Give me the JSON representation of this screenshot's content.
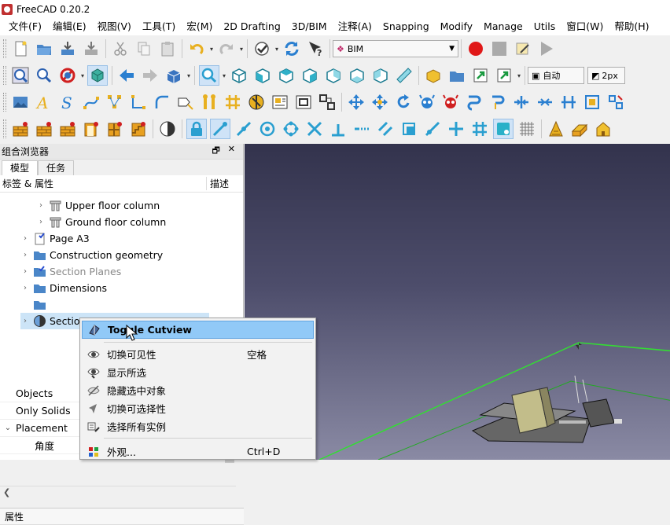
{
  "window": {
    "title": "FreeCAD 0.20.2"
  },
  "menubar": {
    "items": [
      "文件(F)",
      "编辑(E)",
      "视图(V)",
      "工具(T)",
      "宏(M)",
      "2D Drafting",
      "3D/BIM",
      "注释(A)",
      "Snapping",
      "Modify",
      "Manage",
      "Utils",
      "窗口(W)",
      "帮助(H)"
    ]
  },
  "toolbar": {
    "workbench_combo": "BIM",
    "draw_style_combo": "自动",
    "line_width_combo": "2px"
  },
  "panel": {
    "title": "组合浏览器",
    "tabs": [
      "模型",
      "任务"
    ],
    "active_tab": "模型",
    "col_label": "标签 & 属性",
    "col_desc": "描述",
    "tree": [
      {
        "label": "Upper floor column",
        "icon": "column-icon",
        "dim": false
      },
      {
        "label": "Ground floor column",
        "icon": "column-icon",
        "dim": false
      },
      {
        "label": "Page A3",
        "icon": "page-icon",
        "dim": false
      },
      {
        "label": "Construction geometry",
        "icon": "folder-icon",
        "dim": false
      },
      {
        "label": "Section Planes",
        "icon": "section-folder-icon",
        "dim": true
      },
      {
        "label": "Dimensions",
        "icon": "folder-icon",
        "dim": false
      },
      {
        "label": "",
        "icon": "folder-icon",
        "dim": false
      },
      {
        "label": "Section",
        "icon": "section-plane-icon",
        "dim": false
      }
    ]
  },
  "properties": {
    "header": "属性",
    "rows": [
      {
        "label": "Objects",
        "chev": ""
      },
      {
        "label": "Only Solids",
        "chev": ""
      },
      {
        "label": "Placement",
        "chev": "v"
      },
      {
        "label": "角度",
        "chev": ""
      }
    ]
  },
  "context_menu": {
    "items": [
      {
        "label": "Toggle Cutview",
        "shortcut": "",
        "icon": "cutview-icon",
        "highlight": true
      },
      {
        "label": "切换可见性",
        "shortcut": "空格",
        "icon": "eye-icon",
        "highlight": false
      },
      {
        "label": "显示所选",
        "shortcut": "",
        "icon": "eye-selected-icon",
        "highlight": false
      },
      {
        "label": "隐藏选中对象",
        "shortcut": "",
        "icon": "eye-hidden-icon",
        "highlight": false
      },
      {
        "label": "切换可选择性",
        "shortcut": "",
        "icon": "cursor-icon",
        "highlight": false
      },
      {
        "label": "选择所有实例",
        "shortcut": "",
        "icon": "instances-icon",
        "highlight": false
      },
      {
        "label": "外观...",
        "shortcut": "Ctrl+D",
        "icon": "appearance-icon",
        "highlight": false
      }
    ]
  },
  "colors": {
    "accent": "#91c9f7",
    "viewport_top": "#33334d",
    "viewport_bottom": "#8a8aa4",
    "green": "#33dd33"
  }
}
